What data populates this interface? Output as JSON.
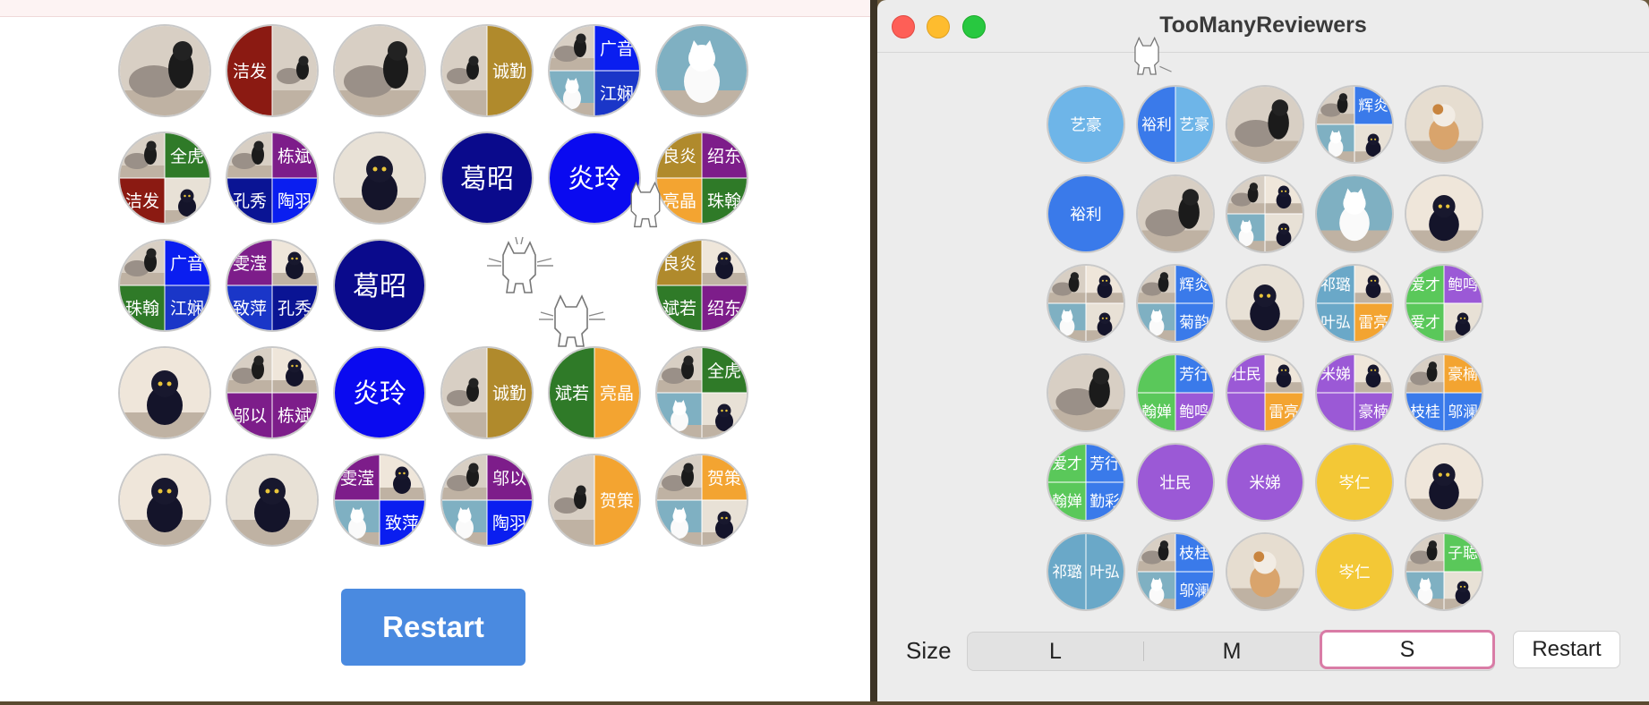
{
  "left_panel": {
    "restart_label": "Restart",
    "tiles": [
      [
        {
          "kind": "photo",
          "scene": "greyblack"
        },
        {
          "kind": "split2",
          "labels": [
            "洁发",
            ""
          ],
          "colors": [
            "#8b1a12",
            "photo"
          ]
        },
        {
          "kind": "photo",
          "scene": "greyblack"
        },
        {
          "kind": "split2",
          "labels": [
            "",
            "诚勤"
          ],
          "colors": [
            "photo",
            "#b08a2c"
          ]
        },
        {
          "kind": "quad",
          "labels": [
            "",
            "广音",
            "",
            "江娴"
          ],
          "colors": [
            "photo",
            "#0a1ef0",
            "photo",
            "#1a36c8"
          ]
        },
        {
          "kind": "photo",
          "scene": "whitecat"
        }
      ],
      [
        {
          "kind": "quad",
          "labels": [
            "",
            "全虎",
            "洁发",
            ""
          ],
          "colors": [
            "photo",
            "#2f7a28",
            "#8b1a12",
            "photo"
          ]
        },
        {
          "kind": "quad",
          "labels": [
            "",
            "栋斌",
            "孔秀",
            "陶羽"
          ],
          "colors": [
            "photo",
            "#7d1d8a",
            "#0a1494",
            "#0a1ef0"
          ]
        },
        {
          "kind": "photo",
          "scene": "blackcat"
        },
        {
          "kind": "solid",
          "labels": [
            "葛昭"
          ],
          "colors": [
            "#0a0a8c"
          ]
        },
        {
          "kind": "solid",
          "labels": [
            "炎玲"
          ],
          "colors": [
            "#0a0af0"
          ]
        },
        {
          "kind": "quad",
          "labels": [
            "良炎",
            "绍东",
            "亮晶",
            "珠翰"
          ],
          "colors": [
            "#b08a2c",
            "#7d1d8a",
            "#f3a431",
            "#2f7a28"
          ]
        }
      ],
      [
        {
          "kind": "quad",
          "labels": [
            "",
            "广音",
            "珠翰",
            "江娴"
          ],
          "colors": [
            "photo",
            "#0a1ef0",
            "#2f7a28",
            "#1a36c8"
          ]
        },
        {
          "kind": "quad",
          "labels": [
            "雯滢",
            "",
            "致萍",
            "孔秀"
          ],
          "colors": [
            "#7d1d8a",
            "photo",
            "#1a36c8",
            "#0a1494"
          ]
        },
        {
          "kind": "solid",
          "labels": [
            "葛昭"
          ],
          "colors": [
            "#0a0a8c"
          ]
        },
        {
          "kind": "empty"
        },
        {
          "kind": "empty"
        },
        {
          "kind": "quad",
          "labels": [
            "良炎",
            "",
            "斌若",
            "绍东"
          ],
          "colors": [
            "#b08a2c",
            "photo",
            "#2f7a28",
            "#7d1d8a"
          ]
        }
      ],
      [
        {
          "kind": "photo",
          "scene": "blackcat2"
        },
        {
          "kind": "quad",
          "labels": [
            "",
            "",
            "邬以",
            "栋斌"
          ],
          "colors": [
            "photo",
            "photo",
            "#7d1d8a",
            "#7d1d8a"
          ]
        },
        {
          "kind": "solid",
          "labels": [
            "炎玲"
          ],
          "colors": [
            "#0a0af0"
          ]
        },
        {
          "kind": "split2",
          "labels": [
            "",
            "诚勤"
          ],
          "colors": [
            "photo",
            "#b08a2c"
          ]
        },
        {
          "kind": "split2",
          "labels": [
            "斌若",
            "亮晶"
          ],
          "colors": [
            "#2f7a28",
            "#f3a431"
          ]
        },
        {
          "kind": "quad",
          "labels": [
            "",
            "全虎",
            "",
            ""
          ],
          "colors": [
            "photo",
            "#2f7a28",
            "photo",
            "photo"
          ]
        }
      ],
      [
        {
          "kind": "photo",
          "scene": "blackcat2"
        },
        {
          "kind": "photo",
          "scene": "blackcat"
        },
        {
          "kind": "quad",
          "labels": [
            "雯滢",
            "",
            "",
            "致萍"
          ],
          "colors": [
            "#7d1d8a",
            "photo",
            "photo",
            "#0a1ef0"
          ]
        },
        {
          "kind": "quad",
          "labels": [
            "",
            "邬以",
            "",
            "陶羽"
          ],
          "colors": [
            "photo",
            "#7d1d8a",
            "photo",
            "#0a1ef0"
          ]
        },
        {
          "kind": "split2",
          "labels": [
            "",
            "贺策"
          ],
          "colors": [
            "photo",
            "#f3a431"
          ]
        },
        {
          "kind": "quad",
          "labels": [
            "",
            "贺策",
            "",
            ""
          ],
          "colors": [
            "photo",
            "#f3a431",
            "photo",
            "photo"
          ]
        }
      ]
    ]
  },
  "window": {
    "title": "TooManyReviewers",
    "size_label": "Size",
    "size_options": [
      "L",
      "M",
      "S"
    ],
    "selected_size": "S",
    "restart_label": "Restart",
    "tiles": [
      [
        {
          "kind": "solid",
          "labels": [
            "艺豪"
          ],
          "colors": [
            "#6eb5e8"
          ]
        },
        {
          "kind": "split2",
          "labels": [
            "裕利",
            "艺豪"
          ],
          "colors": [
            "#3a7aea",
            "#6eb5e8"
          ]
        },
        {
          "kind": "photo",
          "scene": "greyblack"
        },
        {
          "kind": "quad",
          "labels": [
            "",
            "辉炎",
            "",
            ""
          ],
          "colors": [
            "photo",
            "#3a7aea",
            "photo",
            "photo"
          ]
        },
        {
          "kind": "photo",
          "scene": "tabby"
        }
      ],
      [
        {
          "kind": "solid",
          "labels": [
            "裕利"
          ],
          "colors": [
            "#3a7aea"
          ]
        },
        {
          "kind": "photo",
          "scene": "greyblack"
        },
        {
          "kind": "quad",
          "labels": [
            "",
            "",
            "",
            ""
          ],
          "colors": [
            "photo",
            "photo",
            "photo",
            "photo"
          ]
        },
        {
          "kind": "photo",
          "scene": "whitecat"
        },
        {
          "kind": "photo",
          "scene": "blackcat2"
        }
      ],
      [
        {
          "kind": "quad",
          "labels": [
            "",
            "",
            "",
            ""
          ],
          "colors": [
            "photo",
            "photo",
            "photo",
            "photo"
          ]
        },
        {
          "kind": "quad",
          "labels": [
            "",
            "辉炎",
            "",
            "菊韵"
          ],
          "colors": [
            "photo",
            "#3a7aea",
            "photo",
            "#3a7aea"
          ]
        },
        {
          "kind": "photo",
          "scene": "blackcat"
        },
        {
          "kind": "quad",
          "labels": [
            "祁璐",
            "",
            "叶弘",
            "雷亮"
          ],
          "colors": [
            "#6aa8c8",
            "photo",
            "#6aa8c8",
            "#f3a431"
          ]
        },
        {
          "kind": "quad",
          "labels": [
            "爱才",
            "鲍鸣",
            "爱才",
            ""
          ],
          "colors": [
            "#5ac85a",
            "#9b59d6",
            "#5ac85a",
            "photo"
          ]
        }
      ],
      [
        {
          "kind": "photo",
          "scene": "greyblack"
        },
        {
          "kind": "quad",
          "labels": [
            "",
            "芳行",
            "翰婵",
            "鲍鸣"
          ],
          "colors": [
            "#5ac85a",
            "#3a7aea",
            "#5ac85a",
            "#9b59d6"
          ]
        },
        {
          "kind": "quad",
          "labels": [
            "壮民",
            "",
            "",
            "雷亮"
          ],
          "colors": [
            "#9b59d6",
            "photo",
            "#9b59d6",
            "#f3a431"
          ]
        },
        {
          "kind": "quad",
          "labels": [
            "米娣",
            "",
            "",
            "豪楠"
          ],
          "colors": [
            "#9b59d6",
            "photo",
            "#9b59d6",
            "#9b59d6"
          ]
        },
        {
          "kind": "quad",
          "labels": [
            "",
            "豪楠",
            "枝桂",
            "邬澜"
          ],
          "colors": [
            "photo",
            "#f3a431",
            "#3a7aea",
            "#3a7aea"
          ]
        }
      ],
      [
        {
          "kind": "quad",
          "labels": [
            "爱才",
            "芳行",
            "翰婵",
            "勤彩"
          ],
          "colors": [
            "#5ac85a",
            "#3a7aea",
            "#5ac85a",
            "#3a7aea"
          ]
        },
        {
          "kind": "solid",
          "labels": [
            "壮民"
          ],
          "colors": [
            "#9b59d6"
          ]
        },
        {
          "kind": "solid",
          "labels": [
            "米娣"
          ],
          "colors": [
            "#9b59d6"
          ]
        },
        {
          "kind": "solid",
          "labels": [
            "岑仁"
          ],
          "colors": [
            "#f3c836"
          ]
        },
        {
          "kind": "photo",
          "scene": "blackcat2"
        }
      ],
      [
        {
          "kind": "split2",
          "labels": [
            "祁璐",
            "叶弘"
          ],
          "colors": [
            "#6aa8c8",
            "#6aa8c8"
          ]
        },
        {
          "kind": "quad",
          "labels": [
            "",
            "枝桂",
            "",
            "邬澜"
          ],
          "colors": [
            "photo",
            "#3a7aea",
            "photo",
            "#3a7aea"
          ]
        },
        {
          "kind": "photo",
          "scene": "tabby"
        },
        {
          "kind": "solid",
          "labels": [
            "岑仁"
          ],
          "colors": [
            "#f3c836"
          ]
        },
        {
          "kind": "quad",
          "labels": [
            "",
            "子聪",
            "",
            ""
          ],
          "colors": [
            "photo",
            "#5ac85a",
            "photo",
            "photo"
          ]
        }
      ]
    ]
  }
}
